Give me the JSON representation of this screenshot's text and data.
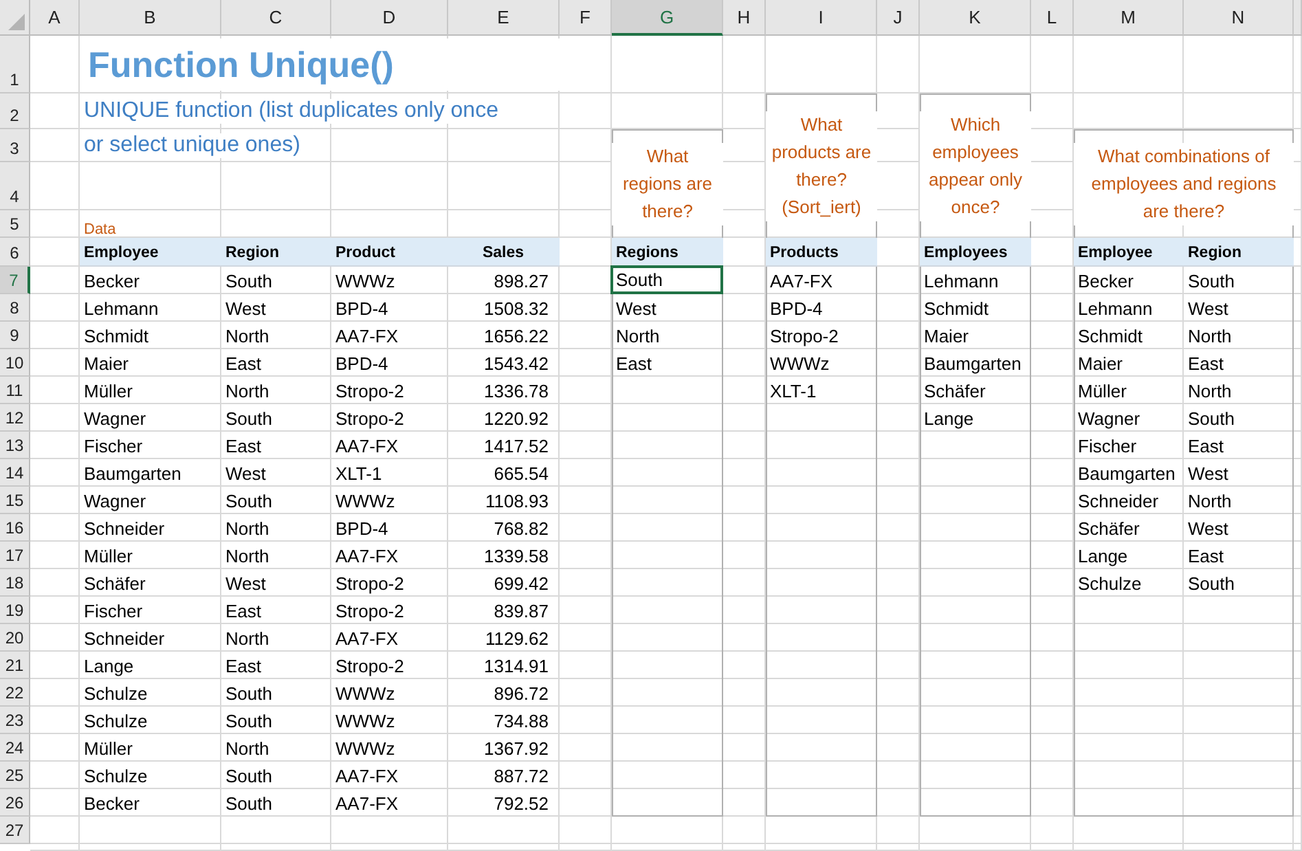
{
  "column_headers": [
    {
      "label": "A",
      "selected": false
    },
    {
      "label": "B",
      "selected": false
    },
    {
      "label": "C",
      "selected": false
    },
    {
      "label": "D",
      "selected": false
    },
    {
      "label": "E",
      "selected": false
    },
    {
      "label": "F",
      "selected": false
    },
    {
      "label": "G",
      "selected": true
    },
    {
      "label": "H",
      "selected": false
    },
    {
      "label": "I",
      "selected": false
    },
    {
      "label": "J",
      "selected": false
    },
    {
      "label": "K",
      "selected": false
    },
    {
      "label": "L",
      "selected": false
    },
    {
      "label": "M",
      "selected": false
    },
    {
      "label": "N",
      "selected": false
    }
  ],
  "row_numbers": [
    {
      "label": "1",
      "selected": false
    },
    {
      "label": "2",
      "selected": false
    },
    {
      "label": "3",
      "selected": false
    },
    {
      "label": "4",
      "selected": false
    },
    {
      "label": "5",
      "selected": false
    },
    {
      "label": "6",
      "selected": false
    },
    {
      "label": "7",
      "selected": true
    },
    {
      "label": "8",
      "selected": false
    },
    {
      "label": "9",
      "selected": false
    },
    {
      "label": "10",
      "selected": false
    },
    {
      "label": "11",
      "selected": false
    },
    {
      "label": "12",
      "selected": false
    },
    {
      "label": "13",
      "selected": false
    },
    {
      "label": "14",
      "selected": false
    },
    {
      "label": "15",
      "selected": false
    },
    {
      "label": "16",
      "selected": false
    },
    {
      "label": "17",
      "selected": false
    },
    {
      "label": "18",
      "selected": false
    },
    {
      "label": "19",
      "selected": false
    },
    {
      "label": "20",
      "selected": false
    },
    {
      "label": "21",
      "selected": false
    },
    {
      "label": "22",
      "selected": false
    },
    {
      "label": "23",
      "selected": false
    },
    {
      "label": "24",
      "selected": false
    },
    {
      "label": "25",
      "selected": false
    },
    {
      "label": "26",
      "selected": false
    },
    {
      "label": "27",
      "selected": false
    }
  ],
  "title": "Function Unique()",
  "subtitle_lines": [
    "UNIQUE function (list duplicates only once",
    "or select unique ones)"
  ],
  "section_label": "Data",
  "data_table": {
    "columns": [
      "Employee",
      "Region",
      "Product",
      "Sales"
    ],
    "rows": [
      [
        "Becker",
        "South",
        "WWWz",
        "898.27"
      ],
      [
        "Lehmann",
        "West",
        "BPD-4",
        "1508.32"
      ],
      [
        "Schmidt",
        "North",
        "AA7-FX",
        "1656.22"
      ],
      [
        "Maier",
        "East",
        "BPD-4",
        "1543.42"
      ],
      [
        "Müller",
        "North",
        "Stropo-2",
        "1336.78"
      ],
      [
        "Wagner",
        "South",
        "Stropo-2",
        "1220.92"
      ],
      [
        "Fischer",
        "East",
        "AA7-FX",
        "1417.52"
      ],
      [
        "Baumgarten",
        "West",
        "XLT-1",
        "665.54"
      ],
      [
        "Wagner",
        "South",
        "WWWz",
        "1108.93"
      ],
      [
        "Schneider",
        "North",
        "BPD-4",
        "768.82"
      ],
      [
        "Müller",
        "North",
        "AA7-FX",
        "1339.58"
      ],
      [
        "Schäfer",
        "West",
        "Stropo-2",
        "699.42"
      ],
      [
        "Fischer",
        "East",
        "Stropo-2",
        "839.87"
      ],
      [
        "Schneider",
        "North",
        "AA7-FX",
        "1129.62"
      ],
      [
        "Lange",
        "East",
        "Stropo-2",
        "1314.91"
      ],
      [
        "Schulze",
        "South",
        "WWWz",
        "896.72"
      ],
      [
        "Schulze",
        "South",
        "WWWz",
        "734.88"
      ],
      [
        "Müller",
        "North",
        "WWWz",
        "1367.92"
      ],
      [
        "Schulze",
        "South",
        "AA7-FX",
        "887.72"
      ],
      [
        "Becker",
        "South",
        "AA7-FX",
        "792.52"
      ]
    ]
  },
  "results": [
    {
      "question": "What regions are there?",
      "columns": [
        "Regions"
      ],
      "rows": [
        {
          "cells": [
            "South"
          ],
          "selected": true
        },
        {
          "cells": [
            "West"
          ],
          "selected": false
        },
        {
          "cells": [
            "North"
          ],
          "selected": false
        },
        {
          "cells": [
            "East"
          ],
          "selected": false
        }
      ]
    },
    {
      "question": "What products are there? (Sort_iert)",
      "columns": [
        "Products"
      ],
      "rows": [
        {
          "cells": [
            "AA7-FX"
          ],
          "selected": false
        },
        {
          "cells": [
            "BPD-4"
          ],
          "selected": false
        },
        {
          "cells": [
            "Stropo-2"
          ],
          "selected": false
        },
        {
          "cells": [
            "WWWz"
          ],
          "selected": false
        },
        {
          "cells": [
            "XLT-1"
          ],
          "selected": false
        }
      ]
    },
    {
      "question": "Which employees appear only once?",
      "columns": [
        "Employees"
      ],
      "rows": [
        {
          "cells": [
            "Lehmann"
          ],
          "selected": false
        },
        {
          "cells": [
            "Schmidt"
          ],
          "selected": false
        },
        {
          "cells": [
            "Maier"
          ],
          "selected": false
        },
        {
          "cells": [
            "Baumgarten"
          ],
          "selected": false
        },
        {
          "cells": [
            "Schäfer"
          ],
          "selected": false
        },
        {
          "cells": [
            "Lange"
          ],
          "selected": false
        }
      ]
    },
    {
      "question": "What combinations of employees and regions are there?",
      "columns": [
        "Employee",
        "Region"
      ],
      "rows": [
        {
          "cells": [
            "Becker",
            "South"
          ],
          "selected": false
        },
        {
          "cells": [
            "Lehmann",
            "West"
          ],
          "selected": false
        },
        {
          "cells": [
            "Schmidt",
            "North"
          ],
          "selected": false
        },
        {
          "cells": [
            "Maier",
            "East"
          ],
          "selected": false
        },
        {
          "cells": [
            "Müller",
            "North"
          ],
          "selected": false
        },
        {
          "cells": [
            "Wagner",
            "South"
          ],
          "selected": false
        },
        {
          "cells": [
            "Fischer",
            "East"
          ],
          "selected": false
        },
        {
          "cells": [
            "Baumgarten",
            "West"
          ],
          "selected": false
        },
        {
          "cells": [
            "Schneider",
            "North"
          ],
          "selected": false
        },
        {
          "cells": [
            "Schäfer",
            "West"
          ],
          "selected": false
        },
        {
          "cells": [
            "Lange",
            "East"
          ],
          "selected": false
        },
        {
          "cells": [
            "Schulze",
            "South"
          ],
          "selected": false
        }
      ]
    }
  ]
}
